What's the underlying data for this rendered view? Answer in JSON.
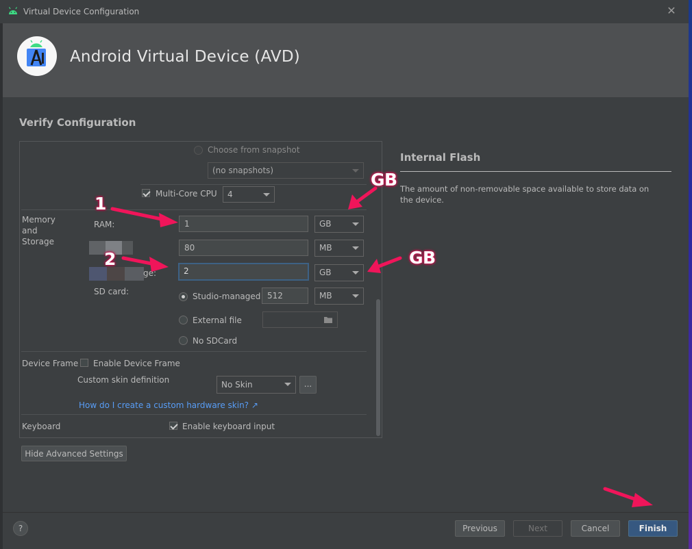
{
  "window": {
    "title": "Virtual Device Configuration",
    "close_glyph": "✕"
  },
  "banner": {
    "title": "Android Virtual Device (AVD)"
  },
  "section_title": "Verify Configuration",
  "form": {
    "snapshot": {
      "choose_label": "Choose from snapshot",
      "dropdown_value": "(no snapshots)"
    },
    "multicore": {
      "label": "Multi-Core CPU",
      "checked": true,
      "value": "4"
    },
    "memory": {
      "group_label_lines": [
        "Memory",
        "and",
        "Storage"
      ],
      "ram_label": "RAM:",
      "ram_value": "1",
      "ram_unit": "GB",
      "heap_value": "80",
      "heap_unit": "MB",
      "storage_label_fragment": "ge:",
      "storage_value": "2",
      "storage_unit": "GB",
      "sdcard_label": "SD card:",
      "studio_managed_label": "Studio-managed",
      "sdcard_value": "512",
      "sdcard_unit": "MB",
      "external_file_label": "External file",
      "no_sdcard_label": "No SDCard"
    },
    "device_frame": {
      "group_label": "Device Frame",
      "enable_label": "Enable Device Frame",
      "skin_label": "Custom skin definition",
      "skin_value": "No Skin",
      "more_button": "...",
      "help_link": "How do I create a custom hardware skin? ↗"
    },
    "keyboard": {
      "group_label": "Keyboard",
      "enable_label": "Enable keyboard input",
      "checked": true
    }
  },
  "hide_advanced_button": "Hide Advanced Settings",
  "help": {
    "title": "Internal Flash",
    "text": "The amount of non-removable space available to store data on the device."
  },
  "footer": {
    "help_glyph": "?",
    "previous": "Previous",
    "next": "Next",
    "cancel": "Cancel",
    "finish": "Finish"
  },
  "annotations": {
    "num1": "1",
    "num2": "2",
    "gb_top": "GB",
    "gb_mid": "GB",
    "arrow_color": "#f0155a"
  },
  "colors": {
    "accent": "#365880",
    "link": "#589df6",
    "background": "#3c3f41",
    "banner": "#4e5052"
  }
}
